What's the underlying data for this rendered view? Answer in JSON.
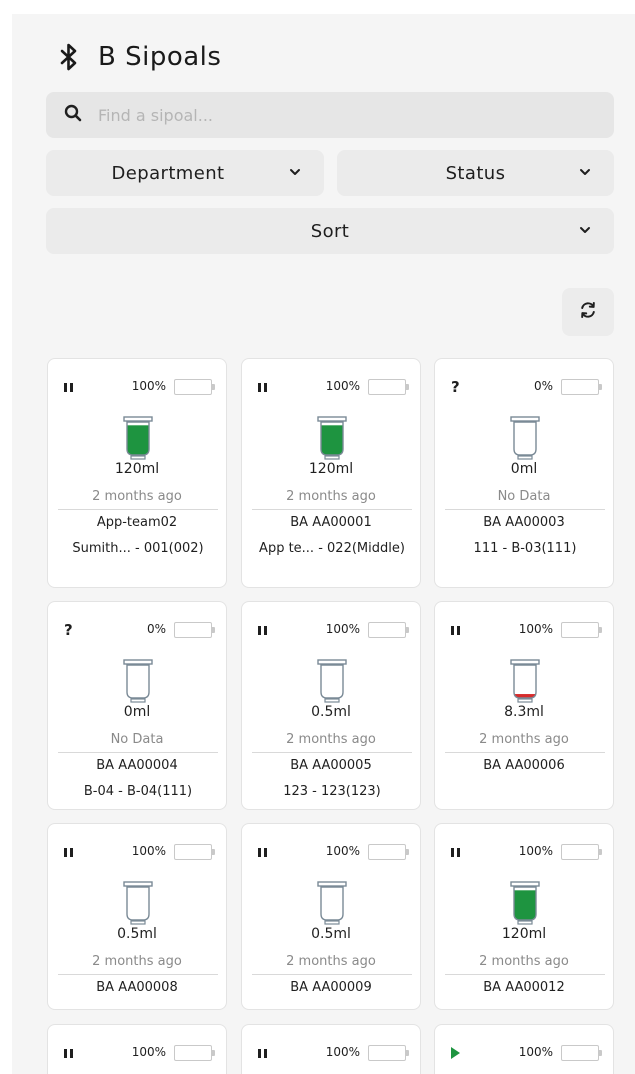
{
  "app": {
    "title": "B Sipoals",
    "icon": "bluetooth-icon"
  },
  "search": {
    "placeholder": "Find a sipoal...",
    "value": ""
  },
  "filters": {
    "department": {
      "label": "Department"
    },
    "status": {
      "label": "Status"
    },
    "sort": {
      "label": "Sort"
    }
  },
  "colors": {
    "fill_green": "#1e9440",
    "fill_red": "#d62c2c",
    "battery_green": "#1e9440"
  },
  "cards": [
    {
      "state": "pause",
      "battery_pct": "100%",
      "battery_level": 1.0,
      "fill_level": 0.9,
      "fill_color": "green",
      "volume": "120ml",
      "ago": "2 months ago",
      "id": "App-team02",
      "loc": "Sumith... - 001(002)"
    },
    {
      "state": "pause",
      "battery_pct": "100%",
      "battery_level": 1.0,
      "fill_level": 0.9,
      "fill_color": "green",
      "volume": "120ml",
      "ago": "2 months ago",
      "id": "BA AA00001",
      "loc": "App te... - 022(Middle)"
    },
    {
      "state": "unknown",
      "battery_pct": "0%",
      "battery_level": 0.0,
      "fill_level": 0.0,
      "fill_color": "green",
      "volume": "0ml",
      "ago": "No Data",
      "id": "BA AA00003",
      "loc": "111 - B-03(111)"
    },
    {
      "state": "unknown",
      "battery_pct": "0%",
      "battery_level": 0.0,
      "fill_level": 0.0,
      "fill_color": "green",
      "volume": "0ml",
      "ago": "No Data",
      "id": "BA AA00004",
      "loc": "B-04 - B-04(111)"
    },
    {
      "state": "pause",
      "battery_pct": "100%",
      "battery_level": 1.0,
      "fill_level": 0.0,
      "fill_color": "green",
      "volume": "0.5ml",
      "ago": "2 months ago",
      "id": "BA AA00005",
      "loc": "123 - 123(123)"
    },
    {
      "state": "pause",
      "battery_pct": "100%",
      "battery_level": 1.0,
      "fill_level": 0.12,
      "fill_color": "red",
      "volume": "8.3ml",
      "ago": "2 months ago",
      "id": "BA AA00006",
      "loc": ""
    },
    {
      "state": "pause",
      "battery_pct": "100%",
      "battery_level": 1.0,
      "fill_level": 0.0,
      "fill_color": "green",
      "volume": "0.5ml",
      "ago": "2 months ago",
      "id": "BA AA00008",
      "loc": ""
    },
    {
      "state": "pause",
      "battery_pct": "100%",
      "battery_level": 1.0,
      "fill_level": 0.0,
      "fill_color": "green",
      "volume": "0.5ml",
      "ago": "2 months ago",
      "id": "BA AA00009",
      "loc": ""
    },
    {
      "state": "pause",
      "battery_pct": "100%",
      "battery_level": 1.0,
      "fill_level": 0.9,
      "fill_color": "green",
      "volume": "120ml",
      "ago": "2 months ago",
      "id": "BA AA00012",
      "loc": ""
    },
    {
      "state": "pause",
      "battery_pct": "100%",
      "battery_level": 1.0,
      "fill_level": null,
      "fill_color": "green",
      "volume": "",
      "ago": "",
      "id": "",
      "loc": ""
    },
    {
      "state": "pause",
      "battery_pct": "100%",
      "battery_level": 1.0,
      "fill_level": null,
      "fill_color": "green",
      "volume": "",
      "ago": "",
      "id": "",
      "loc": ""
    },
    {
      "state": "play",
      "battery_pct": "100%",
      "battery_level": 1.0,
      "fill_level": null,
      "fill_color": "green",
      "volume": "",
      "ago": "",
      "id": "",
      "loc": ""
    }
  ]
}
